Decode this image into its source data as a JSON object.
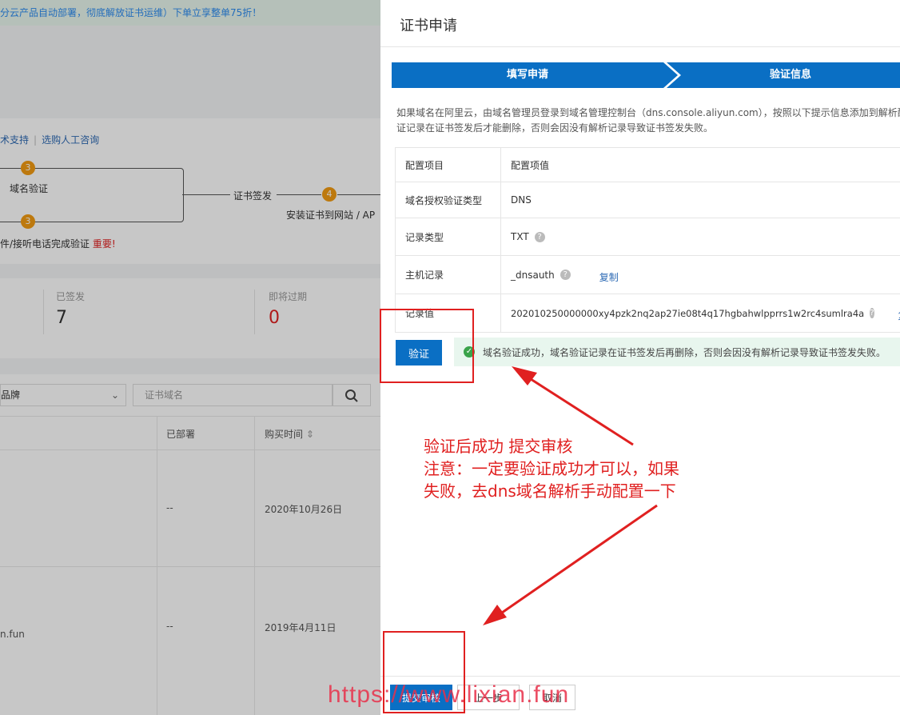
{
  "background": {
    "banner": "分云产品自动部署，彻底解放证书运维）下单立享整单75折！",
    "support_link": "术支持",
    "consult_link": "选购人工咨询",
    "step_domain_verify": "域名验证",
    "step_issue": "证书签发",
    "step_install": "安装证书到网站 / AP",
    "badge_3": "3",
    "badge_4": "4",
    "warn_text": "件/接听电话完成验证",
    "warn_important": "重要!",
    "stat_issued_label": "已签发",
    "stat_issued_value": "7",
    "stat_expiring_label": "即将过期",
    "stat_expiring_value": "0",
    "brand_select": "品牌",
    "domain_search_placeholder": "证书域名",
    "col_deployed": "已部署",
    "col_purchase_time": "购买时间",
    "rows": [
      {
        "domain": "",
        "deployed": "--",
        "time": "2020年10月26日"
      },
      {
        "domain": "n.fun",
        "deployed": "--",
        "time": "2019年4月11日"
      }
    ]
  },
  "drawer": {
    "title": "证书申请",
    "steps": [
      "填写申请",
      "验证信息"
    ],
    "desc_line1": "如果域名在阿里云，由域名管理员登录到域名管理控制台（dns.console.aliyun.com），按照以下提示信息添加到解析配置",
    "desc_line2": "证记录在证书签发后才能删除，否则会因没有解析记录导致证书签发失败。",
    "table": {
      "header": {
        "item": "配置项目",
        "value": "配置项值"
      },
      "rows": [
        {
          "item": "域名授权验证类型",
          "value": "DNS"
        },
        {
          "item": "记录类型",
          "value": "TXT"
        },
        {
          "item": "主机记录",
          "value": "_dnsauth",
          "copy": "复制"
        },
        {
          "item": "记录值",
          "value": "202010250000000xy4pzk2nq2ap27ie08t4q17hgbahwlpprrs1w2rc4sumlra4a",
          "copy": "复制"
        }
      ]
    },
    "verify_button": "验证",
    "success_message": "域名验证成功，域名验证记录在证书签发后再删除，否则会因没有解析记录导致证书签发失败。",
    "submit_button": "提交审核",
    "prev_button": "上一步",
    "cancel_button": "取消"
  },
  "annotation": {
    "line1": "验证后成功 提交审核",
    "line2": "注意：一定要验证成功才可以，如果",
    "line3": "失败，去dns域名解析手动配置一下",
    "watermark": "https://www.lixian.fun"
  },
  "colors": {
    "primary": "#0a6fc4",
    "annotation_red": "#e02020",
    "success_bg": "#e8f6ee",
    "success_icon": "#3aa34a",
    "badge_orange": "#f39c12"
  },
  "icons": [
    "question-icon",
    "check-circle-icon",
    "search-icon",
    "chevron-down-icon",
    "sort-icon"
  ]
}
